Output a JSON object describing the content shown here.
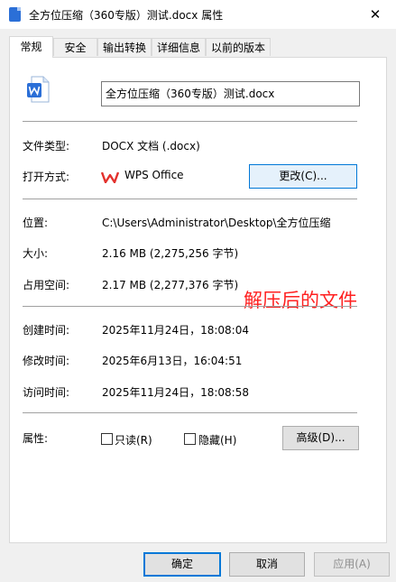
{
  "window": {
    "title": "全方位压缩（360专版）测试.docx 属性",
    "close_glyph": "✕"
  },
  "tabs": [
    {
      "label": "常规",
      "active": true
    },
    {
      "label": "安全"
    },
    {
      "label": "输出转换"
    },
    {
      "label": "详细信息"
    },
    {
      "label": "以前的版本"
    }
  ],
  "general": {
    "file_name": "全方位压缩（360专版）测试.docx",
    "file_type_label": "文件类型:",
    "file_type_value": "DOCX 文档 (.docx)",
    "open_with_label": "打开方式:",
    "open_with_app": "WPS Office",
    "change_button": "更改(C)...",
    "location_label": "位置:",
    "location_value": "C:\\Users\\Administrator\\Desktop\\全方位压缩",
    "size_label": "大小:",
    "size_value": "2.16 MB (2,275,256 字节)",
    "size_on_disk_label": "占用空间:",
    "size_on_disk_value": "2.17 MB (2,277,376 字节)",
    "created_label": "创建时间:",
    "created_value": "2025年11月24日，18:08:04",
    "modified_label": "修改时间:",
    "modified_value": "2025年6月13日，16:04:51",
    "accessed_label": "访问时间:",
    "accessed_value": "2025年11月24日，18:08:58",
    "attributes_label": "属性:",
    "readonly_label": "只读(R)",
    "readonly_checked": false,
    "hidden_label": "隐藏(H)",
    "hidden_checked": false,
    "advanced_button": "高级(D)..."
  },
  "annotation": "解压后的文件",
  "buttons": {
    "ok": "确定",
    "cancel": "取消",
    "apply": "应用(A)"
  },
  "colors": {
    "accent": "#0078d7",
    "annotation": "#ff2020",
    "word_icon": "#2b6fd7",
    "wps_logo": "#e3312d"
  },
  "icons": {
    "title": "word-doc-icon",
    "file": "word-doc-icon",
    "open_with": "wps-logo-icon",
    "close": "close-icon"
  }
}
